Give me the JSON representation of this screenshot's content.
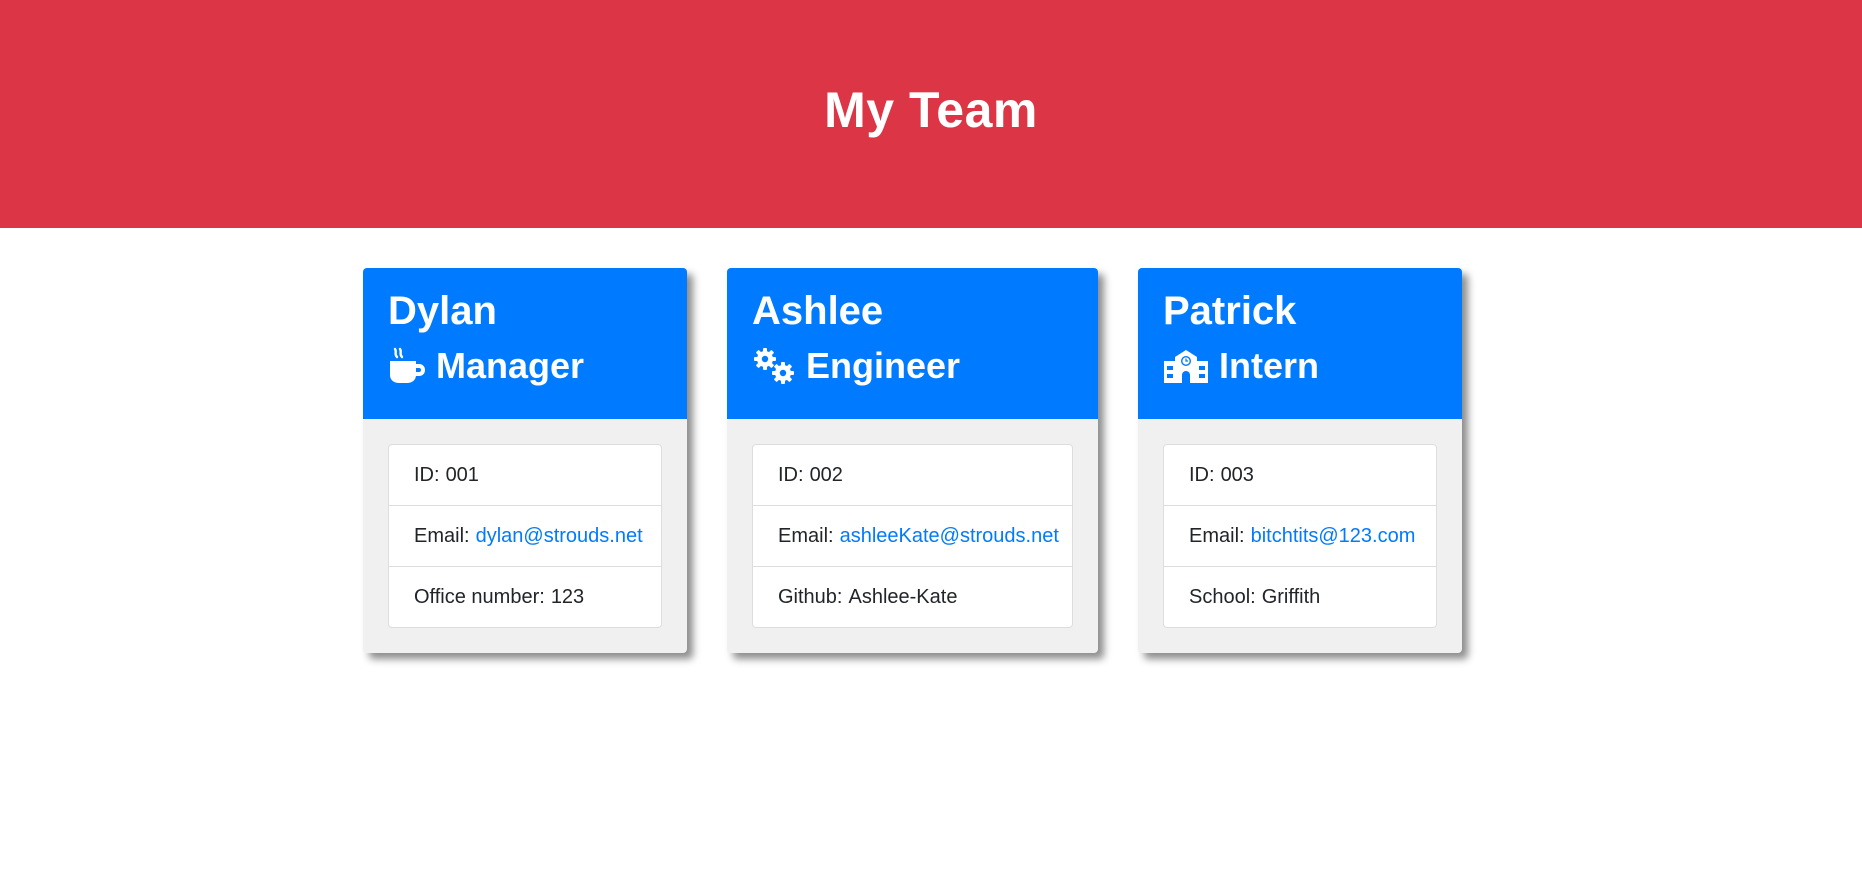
{
  "page": {
    "title": "My Team"
  },
  "colors": {
    "header": "#dc3545",
    "card_header": "#007bff",
    "link": "#007bff"
  },
  "team": [
    {
      "name": "Dylan",
      "role": "Manager",
      "icon": "coffee-icon",
      "id_label": "ID:",
      "id": "001",
      "email_label": "Email:",
      "email": "dylan@strouds.net",
      "extra_label": "Office number:",
      "extra": "123"
    },
    {
      "name": "Ashlee",
      "role": "Engineer",
      "icon": "cogs-icon",
      "id_label": "ID:",
      "id": "002",
      "email_label": "Email:",
      "email": "ashleeKate@strouds.net",
      "extra_label": "Github:",
      "extra": "Ashlee-Kate"
    },
    {
      "name": "Patrick",
      "role": "Intern",
      "icon": "school-icon",
      "id_label": "ID:",
      "id": "003",
      "email_label": "Email:",
      "email": "bitchtits@123.com",
      "extra_label": "School:",
      "extra": "Griffith"
    }
  ]
}
